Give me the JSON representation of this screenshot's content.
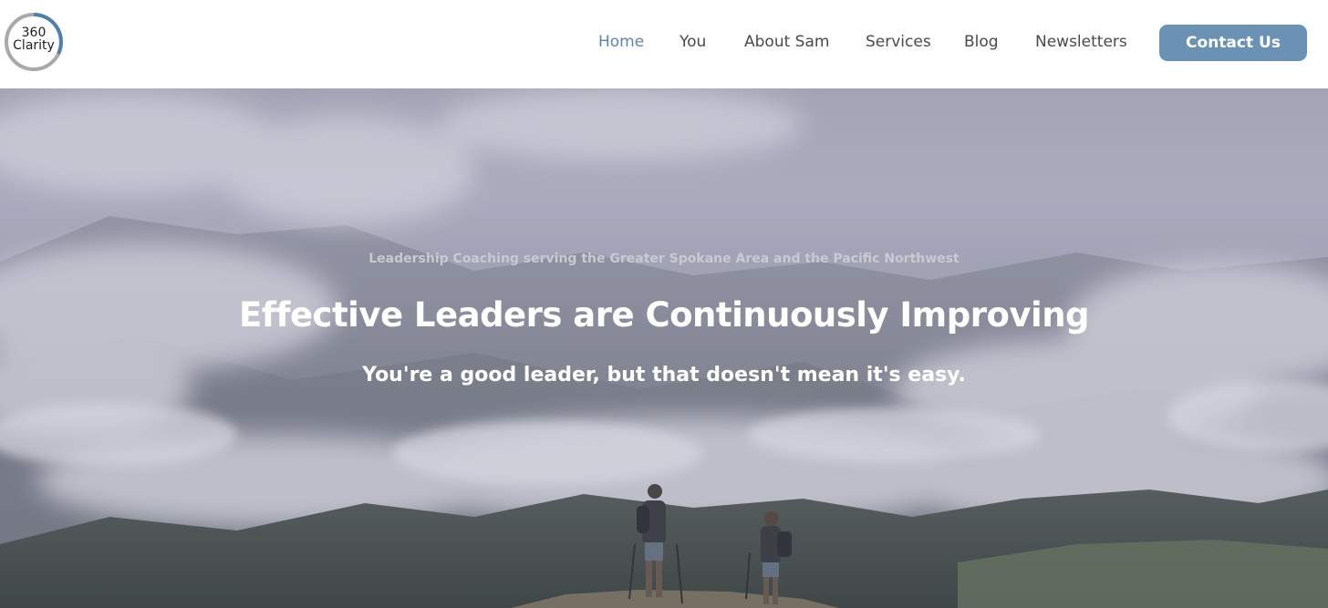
{
  "brand": {
    "logo_line1": "360",
    "logo_line2": "Clarity",
    "ring_color": "#a9a9a9",
    "accent_color": "#4f7fad"
  },
  "nav": {
    "items": [
      {
        "label": "Home",
        "active": true
      },
      {
        "label": "You",
        "active": false
      },
      {
        "label": "About Sam",
        "active": false
      },
      {
        "label": "Services",
        "active": false
      },
      {
        "label": "Blog",
        "active": false
      },
      {
        "label": "Newsletters",
        "active": false
      }
    ],
    "active_color": "#5e86ad",
    "text_color": "#4a4a4a"
  },
  "cta": {
    "label": "Contact Us",
    "color": "#6b92b5"
  },
  "hero": {
    "tagline": "Leadership Coaching serving the Greater Spokane Area and the Pacific Northwest",
    "headline": "Effective Leaders are Continuously Improving",
    "subline": "You're a good leader, but that doesn't mean it's easy."
  }
}
